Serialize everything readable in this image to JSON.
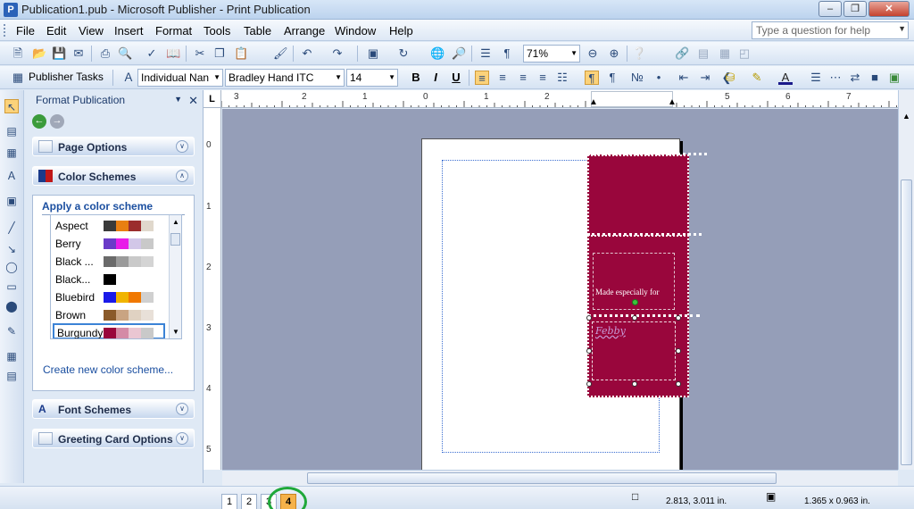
{
  "window": {
    "title": "Publication1.pub - Microsoft Publisher - Print Publication"
  },
  "menu": [
    "File",
    "Edit",
    "View",
    "Insert",
    "Format",
    "Tools",
    "Table",
    "Arrange",
    "Window",
    "Help"
  ],
  "help_box": {
    "placeholder": "Type a question for help"
  },
  "toolbar": {
    "zoom": "71%",
    "publisher_tasks": "Publisher Tasks",
    "style": "Individual Nan",
    "font": "Bradley Hand ITC",
    "size": "14",
    "bold": "B",
    "italic": "I",
    "underline": "U"
  },
  "task_pane": {
    "title": "Format Publication",
    "sections": {
      "page_options": "Page Options",
      "color_schemes": "Color Schemes",
      "font_schemes": "Font Schemes",
      "greeting_card_options": "Greeting Card Options"
    },
    "apply_label": "Apply a color scheme",
    "schemes": [
      {
        "name": "Aspect",
        "colors": [
          "#3a3a3a",
          "#e87f12",
          "#9b2c2c",
          "#e0d8cc"
        ]
      },
      {
        "name": "Berry",
        "colors": [
          "#6a3bc8",
          "#e81ce8",
          "#d2c7e8",
          "#c9c9c9"
        ]
      },
      {
        "name": "Black ...",
        "colors": [
          "#6a6a6a",
          "#9a9a9a",
          "#c9c9c9",
          "#d4d4d4"
        ]
      },
      {
        "name": "Black...",
        "colors": [
          "#000000"
        ]
      },
      {
        "name": "Bluebird",
        "colors": [
          "#1a1ae8",
          "#f0b400",
          "#f07800",
          "#d0d0d0"
        ]
      },
      {
        "name": "Brown",
        "colors": [
          "#8a5a2a",
          "#c9a482",
          "#e0d2c2",
          "#e8e0d8"
        ]
      },
      {
        "name": "Burgundy",
        "colors": [
          "#99063c",
          "#d48aa6",
          "#eac6d2",
          "#c9c9c9"
        ]
      }
    ],
    "selected_scheme": "Burgundy",
    "create_link": "Create new color scheme..."
  },
  "rulers": {
    "h_labels": [
      "3",
      "2",
      "1",
      "0",
      "1",
      "2",
      "3",
      "4",
      "5",
      "6",
      "7"
    ],
    "v_labels": [
      "0",
      "1",
      "2",
      "3",
      "4",
      "5"
    ]
  },
  "document": {
    "text_made_for": "Made especially for",
    "text_name": "Febby"
  },
  "status": {
    "pages": [
      "1",
      "2",
      "3",
      "4"
    ],
    "current_page": "4",
    "position": "2.813, 3.011 in.",
    "size": "1.365 x  0.963 in."
  },
  "colors": {
    "accent": "#99063c",
    "canvas": "#959eb8"
  }
}
